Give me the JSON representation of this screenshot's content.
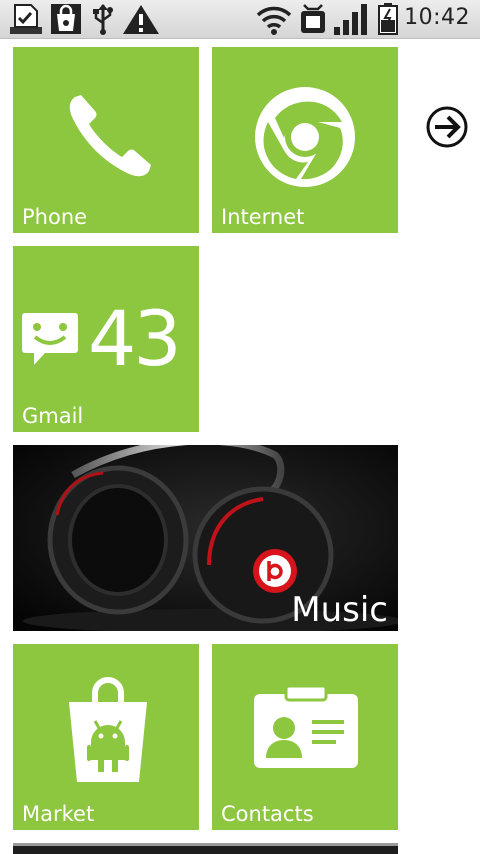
{
  "status_bar": {
    "time": "10:42",
    "left_icons": [
      "task-check-icon",
      "shopping-bag-icon",
      "usb-icon",
      "warning-icon"
    ],
    "right_icons": [
      "wifi-icon",
      "sync-icon",
      "signal-icon",
      "battery-icon"
    ]
  },
  "tiles": {
    "phone": {
      "label": "Phone",
      "icon": "phone-handset-icon"
    },
    "internet": {
      "label": "Internet",
      "icon": "browser-icon"
    },
    "gmail": {
      "label": "Gmail",
      "icon": "message-icon",
      "count": "43"
    },
    "music": {
      "label": "Music",
      "icon": "headphones-image"
    },
    "market": {
      "label": "Market",
      "icon": "market-bag-icon"
    },
    "contacts": {
      "label": "Contacts",
      "icon": "contact-card-icon"
    }
  },
  "navigation": {
    "next_icon": "arrow-right-circle-icon"
  },
  "colors": {
    "tile": "#8dc63f",
    "tile_text": "#ffffff",
    "background": "#ffffff",
    "status_bar": "#e2e2e2"
  }
}
